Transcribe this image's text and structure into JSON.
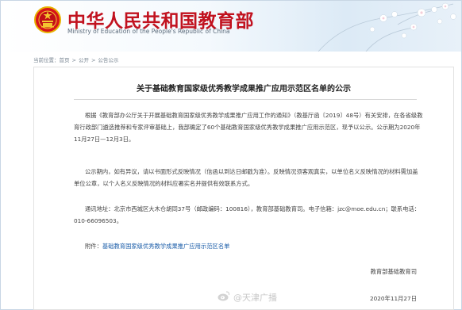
{
  "header": {
    "site_name": "中华人民共和国教育部",
    "site_name_en": "Ministry of Education of the People's Republic of China"
  },
  "breadcrumb": {
    "items": [
      "当前位置：",
      "首页",
      "公开",
      "公告公示"
    ],
    "separator": ">"
  },
  "article": {
    "title": "关于基础教育国家级优秀教学成果推广应用示范区名单的公示",
    "p1": "根据《教育部办公厅关于开展基础教育国家级优秀教学成果推广应用工作的通知》（教基厅函〔2019〕48号）有关安排，在各省级教育行政部门遴选推荐和专家评审基础上，我部确定了60个基础教育国家级优秀教学成果推广应用示范区，现予以公示。公示期为2020年11月27日—12月3日。",
    "p2": "公示期内，如有异议，请以书面形式反映情况（信函以到达日邮戳为准）。反映情况须客观真实，以单位名义反映情况的材料需加盖单位公章，以个人名义反映情况的材料应署实名并提供有效联系方式。",
    "p3": "通讯地址：北京市西城区大木仓胡同37号（邮政编码：100816），教育部基础教育司。电子信箱：jzc@moe.edu.cn；联系电话：010-66096503。",
    "attach_label": "附件：",
    "attach_link": "基础教育国家级优秀教学成果推广应用示范区名单",
    "sign_dept": "教育部基础教育司",
    "sign_date": "2020年11月27日"
  },
  "watermark": {
    "text": "@天津广播"
  },
  "colors": {
    "site_name": "#c1121f",
    "link": "#1a5ca8",
    "border": "#c8d6e4"
  },
  "icons": [
    "national-emblem-icon",
    "blossom-decoration",
    "weibo-icon"
  ]
}
